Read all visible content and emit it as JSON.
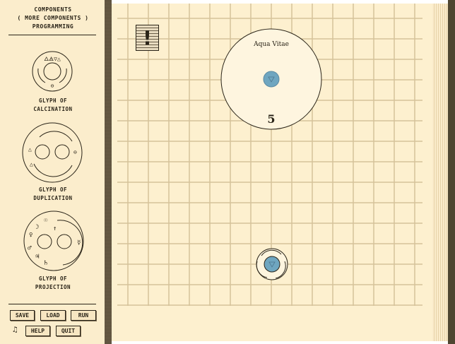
{
  "sidebar": {
    "tabs": [
      "COMPONENTS",
      "( MORE COMPONENTS )",
      "PROGRAMMING"
    ],
    "glyphs": [
      {
        "label_line1": "GLYPH OF",
        "label_line2": "CALCINATION"
      },
      {
        "label_line1": "GLYPH OF",
        "label_line2": "DUPLICATION"
      },
      {
        "label_line1": "GLYPH OF",
        "label_line2": "PROJECTION"
      }
    ],
    "buttons": {
      "save": "SAVE",
      "load": "LOAD",
      "run": "RUN",
      "help": "HELP",
      "quit": "QUIT"
    },
    "music_icon": "♫"
  },
  "board": {
    "reagent": {
      "name": "Aqua Vitae",
      "count": "5"
    },
    "alert_icon": "!"
  },
  "colors": {
    "atom": "#6fa6c0",
    "paper": "#fdf0cf",
    "grid": "#d5c29a"
  }
}
